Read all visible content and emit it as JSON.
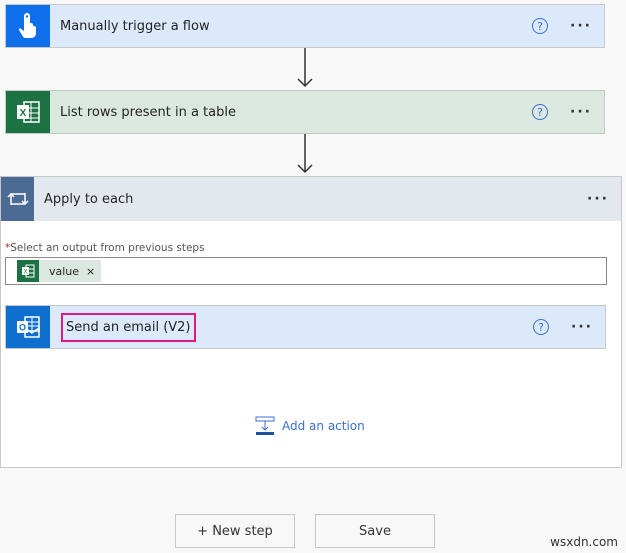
{
  "steps": {
    "trigger": {
      "title": "Manually trigger a flow",
      "icon": "hand-touch-icon",
      "help": "?",
      "more": "···",
      "color": "#0f6fea"
    },
    "list_rows": {
      "title": "List rows present in a table",
      "icon": "excel-icon",
      "help": "?",
      "more": "···",
      "color": "#1d7244"
    },
    "apply_each": {
      "title": "Apply to each",
      "icon": "loop-icon",
      "more": "···",
      "field_label": "Select an output from previous steps",
      "required_mark": "*",
      "token": {
        "label": "value",
        "remove": "×",
        "icon": "excel-icon"
      },
      "inner_step": {
        "title": "Send an email (V2)",
        "icon": "outlook-icon",
        "help": "?",
        "more": "···",
        "highlight_color": "#e0197d"
      },
      "add_action": "Add an action"
    }
  },
  "footer": {
    "new_step": "+ New step",
    "save": "Save"
  },
  "watermark": "wsxdn.com"
}
